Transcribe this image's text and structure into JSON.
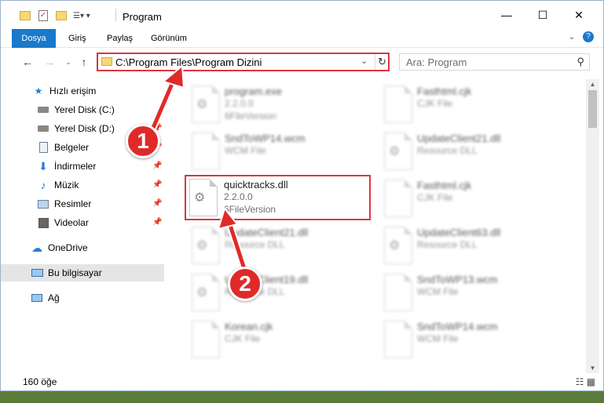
{
  "window": {
    "title": "Program",
    "controls": {
      "minimize": "—",
      "maximize": "☐",
      "close": "✕"
    }
  },
  "ribbon": {
    "tabs": [
      {
        "label": "Dosya"
      },
      {
        "label": "Giriş"
      },
      {
        "label": "Paylaş"
      },
      {
        "label": "Görünüm"
      }
    ]
  },
  "address": {
    "path": "C:\\Program Files\\Program Dizini",
    "search_placeholder": "Ara: Program"
  },
  "navigation": {
    "items": [
      {
        "label": "Hızlı erişim",
        "icon": "star-icon"
      },
      {
        "label": "Yerel Disk (C:)",
        "icon": "drive-icon"
      },
      {
        "label": "Yerel Disk (D:)",
        "icon": "drive-icon"
      },
      {
        "label": "Belgeler",
        "icon": "documents-icon"
      },
      {
        "label": "İndirmeler",
        "icon": "download-icon"
      },
      {
        "label": "Müzik",
        "icon": "music-icon"
      },
      {
        "label": "Resimler",
        "icon": "pictures-icon"
      },
      {
        "label": "Videolar",
        "icon": "videos-icon"
      },
      {
        "label": "OneDrive",
        "icon": "cloud-icon"
      },
      {
        "label": "Bu bilgisayar",
        "icon": "computer-icon"
      },
      {
        "label": "Ağ",
        "icon": "network-icon"
      }
    ]
  },
  "files": [
    {
      "name": "program.exe",
      "line2": "2.2.0.0",
      "line3": "6FileVersion"
    },
    {
      "name": "Fasthtml.cjk",
      "line2": "CJK File",
      "line3": ""
    },
    {
      "name": "SndToWP14.wcm",
      "line2": "WCM File",
      "line3": ""
    },
    {
      "name": "UpdateClient21.dll",
      "line2": "Resource DLL",
      "line3": ""
    },
    {
      "name": "quicktracks.dll",
      "line2": "2.2.0.0",
      "line3": "6FileVersion"
    },
    {
      "name": "Fasthtml.cjk",
      "line2": "CJK File",
      "line3": ""
    },
    {
      "name": "UpdateClient21.dll",
      "line2": "Resource DLL",
      "line3": ""
    },
    {
      "name": "UpdateClient63.dll",
      "line2": "Resource DLL",
      "line3": ""
    },
    {
      "name": "UpdateClient19.dll",
      "line2": "Resource DLL",
      "line3": ""
    },
    {
      "name": "SndToWP13.wcm",
      "line2": "WCM File",
      "line3": ""
    },
    {
      "name": "Korean.cjk",
      "line2": "CJK File",
      "line3": ""
    },
    {
      "name": "SndToWP14.wcm",
      "line2": "WCM File",
      "line3": ""
    }
  ],
  "status": {
    "count": "160 öğe"
  },
  "annotations": {
    "step1": "1",
    "step2": "2"
  },
  "colors": {
    "accent": "#1979ca",
    "highlight": "#d9363e",
    "badge": "#e02a2a"
  }
}
